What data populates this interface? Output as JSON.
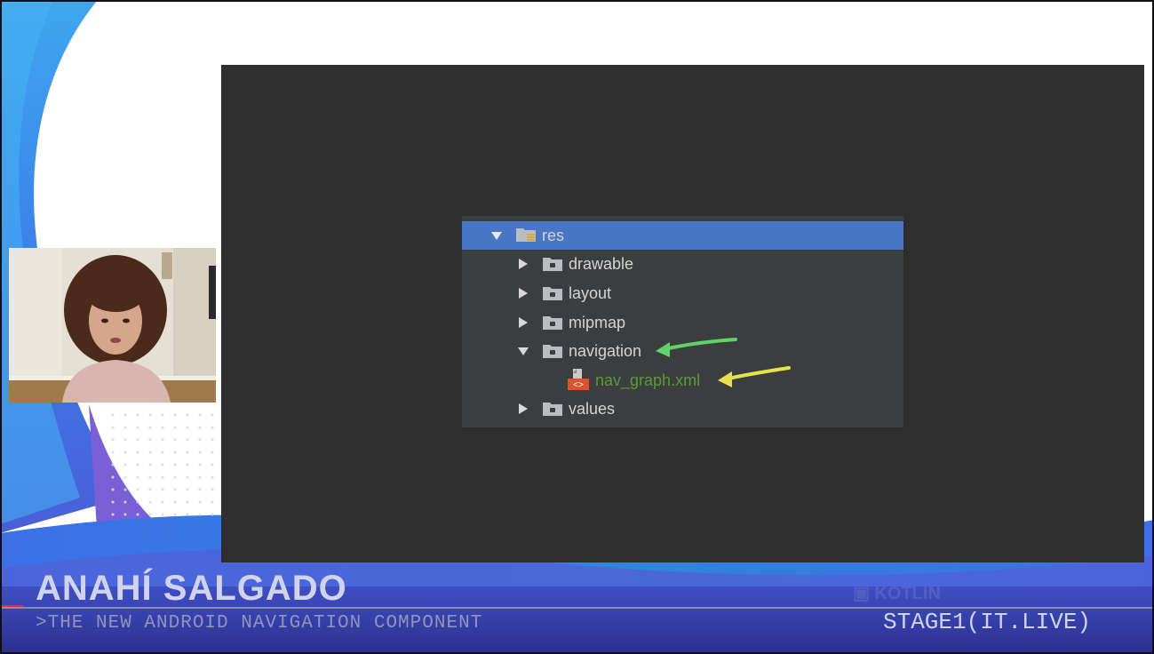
{
  "file_tree": {
    "root": {
      "label": "res",
      "expanded": true,
      "selected": true,
      "icon": "res-folder-icon"
    },
    "items": [
      {
        "label": "drawable",
        "expanded": false,
        "icon": "folder-icon"
      },
      {
        "label": "layout",
        "expanded": false,
        "icon": "folder-icon"
      },
      {
        "label": "mipmap",
        "expanded": false,
        "icon": "folder-icon"
      },
      {
        "label": "navigation",
        "expanded": true,
        "icon": "folder-icon"
      },
      {
        "label": "nav_graph.xml",
        "icon": "xml-file-icon",
        "child_of": "navigation"
      },
      {
        "label": "values",
        "expanded": false,
        "icon": "folder-icon"
      }
    ],
    "annotations": [
      {
        "target": "navigation",
        "color": "#5fd36a",
        "icon": "arrow-annotation-icon"
      },
      {
        "target": "nav_graph.xml",
        "color": "#e7e24a",
        "icon": "arrow-annotation-icon"
      }
    ]
  },
  "lower_third": {
    "speaker_name": "ANAHÍ SALGADO",
    "talk_title": ">THE NEW ANDROID NAVIGATION COMPONENT",
    "event": "STAGE1(IT.LIVE)"
  },
  "colors": {
    "selection": "#4a76c6",
    "wave_blue": "#3f6fe0",
    "wave_purple": "#7b5fd6",
    "editor_bg": "#2e2e2e",
    "panel_bg": "#3b3d3f"
  },
  "webcam": {
    "icon": "speaker-webcam"
  }
}
